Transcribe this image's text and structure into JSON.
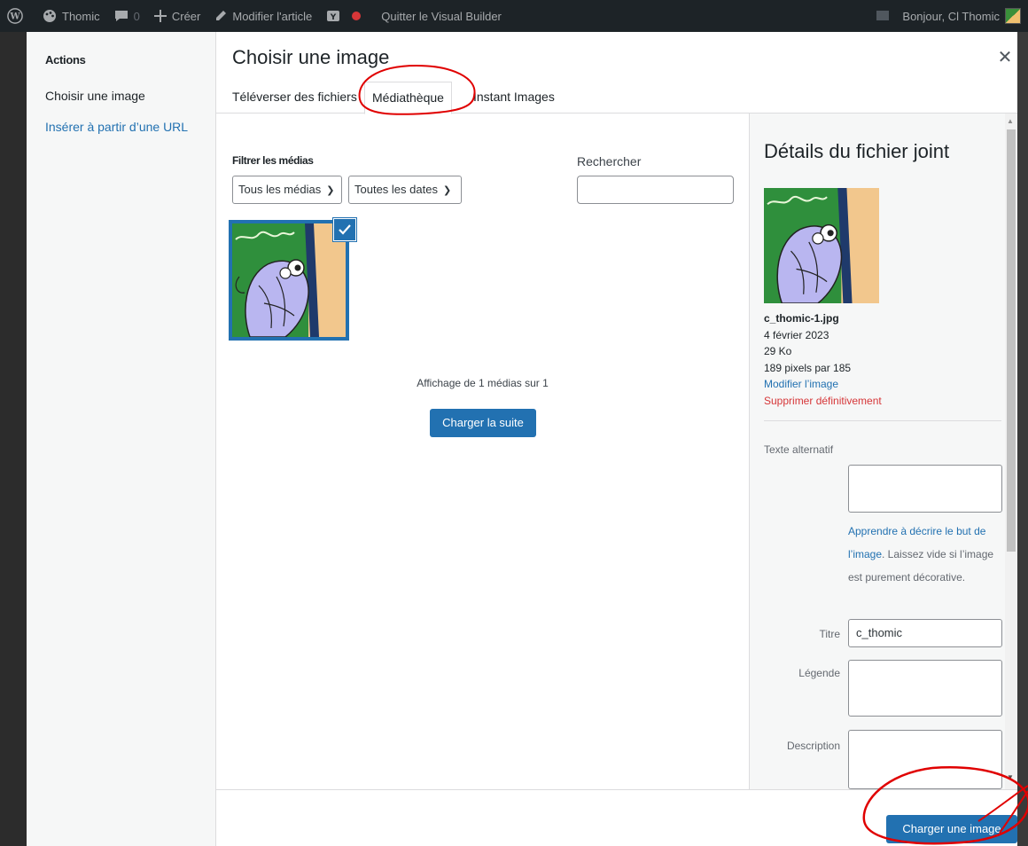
{
  "admin_bar": {
    "site_name": "Thomic",
    "comments_count": "0",
    "create_label": "Créer",
    "edit_label": "Modifier l'article",
    "exit_label": "Quitter le Visual Builder",
    "greeting": "Bonjour, Cl Thomic"
  },
  "menu": {
    "heading": "Actions",
    "active_item": "Choisir une image",
    "link_item": "Insérer à partir d’une URL"
  },
  "modal": {
    "title": "Choisir une image"
  },
  "tabs": [
    {
      "label": "Téléverser des fichiers"
    },
    {
      "label": "Médiathèque"
    },
    {
      "label": "Instant Images"
    }
  ],
  "filters": {
    "label": "Filtrer les médias",
    "type_select": "Tous les médias",
    "date_select": "Toutes les dates",
    "search_label": "Rechercher",
    "search_value": ""
  },
  "grid": {
    "count_text": "Affichage de 1 médias sur 1",
    "load_more": "Charger la suite"
  },
  "details": {
    "title": "Détails du fichier joint",
    "filename": "c_thomic-1.jpg",
    "date": "4 février 2023",
    "size": "29 Ko",
    "dimensions": "189 pixels par 185",
    "edit_link": "Modifier l’image",
    "delete_link": "Supprimer définitivement",
    "alt_label": "Texte alternatif",
    "alt_value": "",
    "help_link": "Apprendre à décrire le but de l’image",
    "help_text": ". Laissez vide si l’image est purement décorative.",
    "title_label": "Titre",
    "title_value": "c_thomic",
    "caption_label": "Légende",
    "caption_value": "",
    "description_label": "Description",
    "description_value": ""
  },
  "toolbar": {
    "primary_button": "Charger une image"
  },
  "colors": {
    "accent": "#2271b1",
    "danger": "#d63638",
    "annotation": "#e00000"
  }
}
